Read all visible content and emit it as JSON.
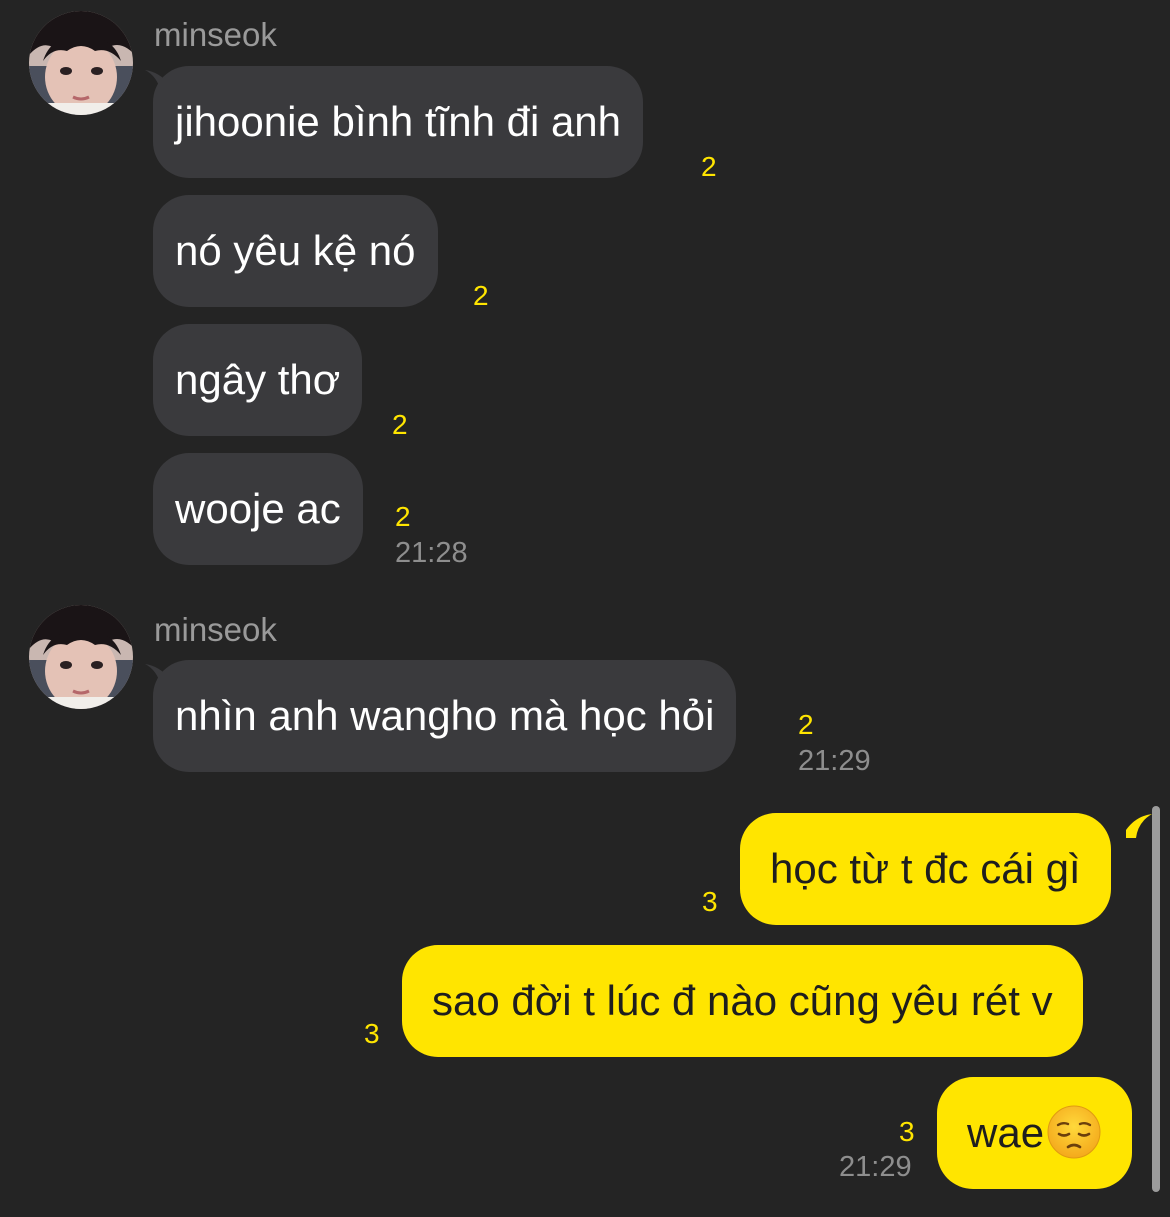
{
  "groups": [
    {
      "sender": "minseok",
      "avatar_icon": "profile-photo",
      "messages": [
        {
          "text": "jihoonie bình tĩnh đi anh",
          "unread": "2"
        },
        {
          "text": "nó yêu kệ nó",
          "unread": "2"
        },
        {
          "text": "ngây thơ",
          "unread": "2"
        },
        {
          "text": "wooje ac",
          "unread": "2",
          "time": "21:28"
        }
      ]
    },
    {
      "sender": "minseok",
      "avatar_icon": "profile-photo",
      "messages": [
        {
          "text": "nhìn anh wangho mà học hỏi",
          "unread": "2",
          "time": "21:29"
        }
      ]
    }
  ],
  "outgoing": [
    {
      "text": "học từ t đc cái gì",
      "unread": "3"
    },
    {
      "text": "sao đời t lúc đ nào cũng yêu rét v",
      "unread": "3"
    },
    {
      "text": "wae",
      "emoji": "pensive-face",
      "unread": "3",
      "time": "21:29"
    }
  ],
  "colors": {
    "background": "#242424",
    "incoming_bubble": "#3a3a3d",
    "outgoing_bubble": "#ffe500",
    "unread_count": "#ffe500",
    "timestamp": "#8e8e8e"
  }
}
